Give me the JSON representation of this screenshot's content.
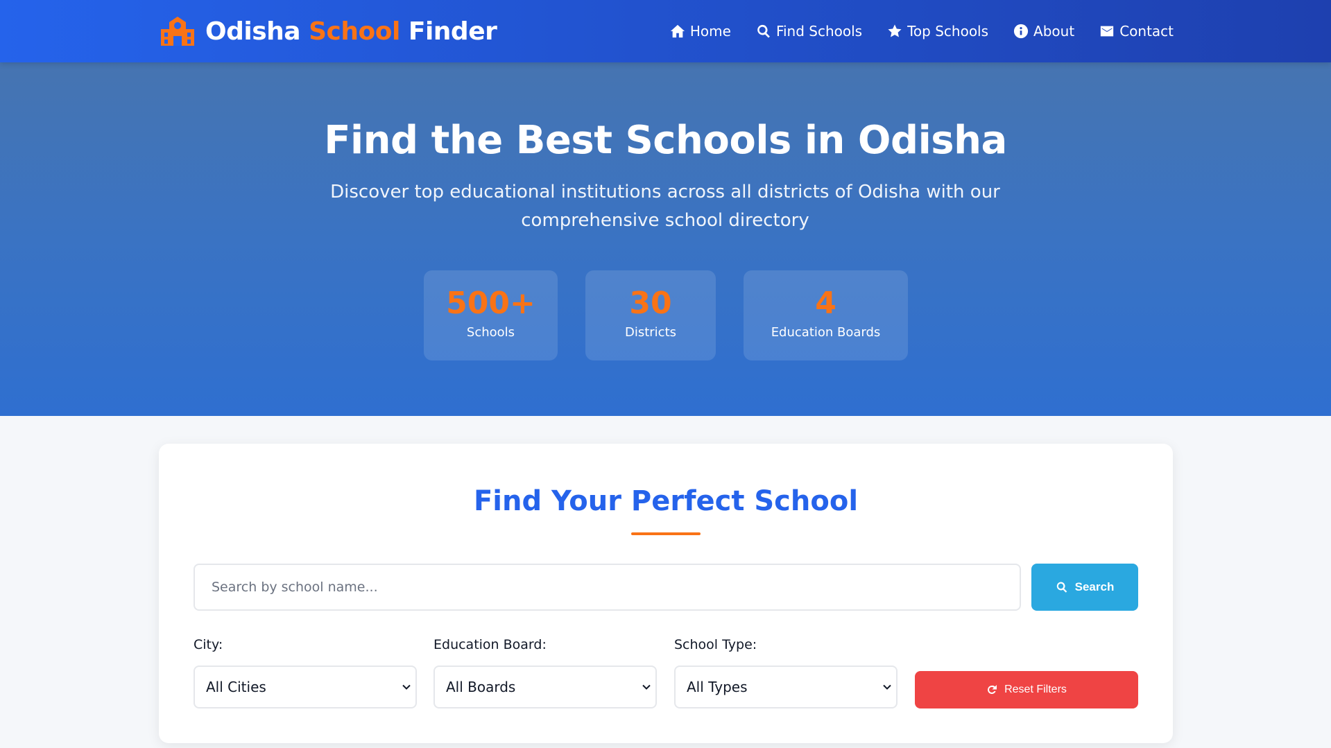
{
  "brand": {
    "name_part1": "Odisha",
    "name_part2": "School",
    "name_part3": "Finder",
    "icon": "school-icon",
    "accent_color": "#f97316"
  },
  "nav": {
    "items": [
      {
        "label": "Home",
        "icon": "home-icon"
      },
      {
        "label": "Find Schools",
        "icon": "search-icon"
      },
      {
        "label": "Top Schools",
        "icon": "star-icon"
      },
      {
        "label": "About",
        "icon": "info-icon"
      },
      {
        "label": "Contact",
        "icon": "envelope-icon"
      }
    ]
  },
  "hero": {
    "title": "Find the Best Schools in Odisha",
    "subtitle": "Discover top educational institutions across all districts of Odisha with our comprehensive school directory",
    "stats": [
      {
        "value": "500+",
        "label": "Schools"
      },
      {
        "value": "30",
        "label": "Districts"
      },
      {
        "value": "4",
        "label": "Education Boards"
      }
    ]
  },
  "search": {
    "title": "Find Your Perfect School",
    "input_placeholder": "Search by school name...",
    "input_value": "",
    "button_label": "Search",
    "filters": [
      {
        "label": "City:",
        "selected": "All Cities"
      },
      {
        "label": "Education Board:",
        "selected": "All Boards"
      },
      {
        "label": "School Type:",
        "selected": "All Types"
      }
    ],
    "reset_label": "Reset Filters"
  },
  "colors": {
    "primary": "#2563eb",
    "search_button": "#2aa8e0",
    "reset_button": "#ef4444"
  }
}
